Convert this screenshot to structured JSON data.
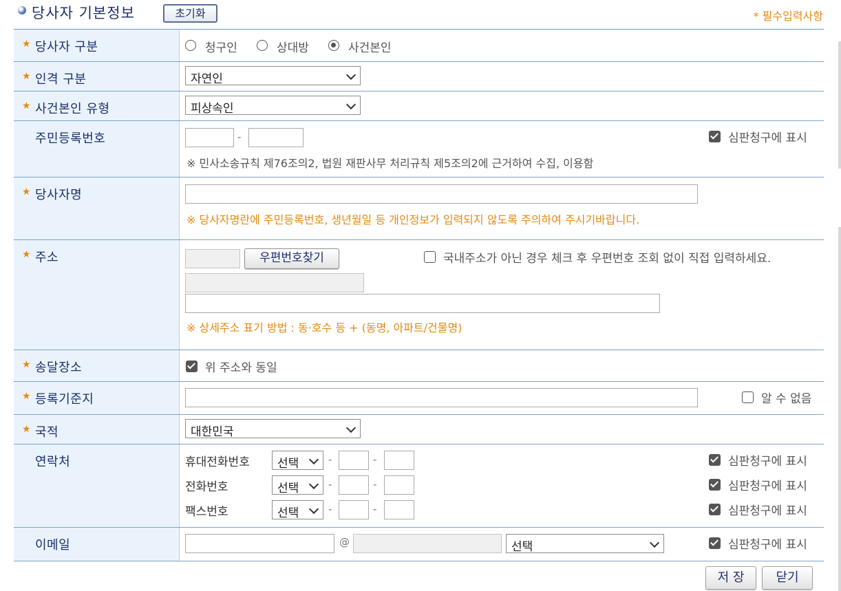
{
  "header": {
    "title": "당사자 기본정보",
    "reset_label": "초기화",
    "required_note": "* 필수입력사항"
  },
  "labels": {
    "party_type": "당사자 구분",
    "person_type": "인격 구분",
    "principal_type": "사건본인 유형",
    "rrn": "주민등록번호",
    "party_name": "당사자명",
    "address": "주소",
    "delivery": "송달장소",
    "registry": "등록기준지",
    "nationality": "국적",
    "contact": "연락처",
    "email": "이메일"
  },
  "party_type": {
    "options": [
      "청구인",
      "상대방",
      "사건본인"
    ],
    "selected": "사건본인"
  },
  "person_type": {
    "value": "자연인"
  },
  "principal_type": {
    "value": "피상속인"
  },
  "rrn": {
    "show_label": "심판청구에 표시",
    "notice": "※ 민사소송규칙 제76조의2, 법원 재판사무 처리규칙 제5조의2에 근거하여 수집, 이용함"
  },
  "party_name": {
    "notice": "※ 당사자명란에 주민등록번호, 생년월일 등 개인정보가 입력되지 않도록 주의하여 주시기바랍니다."
  },
  "address": {
    "zip_button": "우편번호찾기",
    "foreign_label": "국내주소가 아닌 경우 체크 후 우편번호 조회 없이 직접 입력하세요.",
    "notice": "※ 상세주소 표기 방법 : 동·호수 등 + (동명, 아파트/건물명)"
  },
  "delivery": {
    "same_label": "위 주소와 동일"
  },
  "registry": {
    "unknown_label": "알 수 없음"
  },
  "nationality": {
    "value": "대한민국"
  },
  "contact": {
    "rows": [
      {
        "label": "휴대전화번호",
        "select": "선택",
        "show_label": "심판청구에 표시"
      },
      {
        "label": "전화번호",
        "select": "선택",
        "show_label": "심판청구에 표시"
      },
      {
        "label": "팩스번호",
        "select": "선택",
        "show_label": "심판청구에 표시"
      }
    ],
    "dash": "-"
  },
  "email": {
    "at": "@",
    "domain_select": "선택",
    "show_label": "심판청구에 표시"
  },
  "buttons": {
    "save": "저 장",
    "close": "닫기"
  }
}
